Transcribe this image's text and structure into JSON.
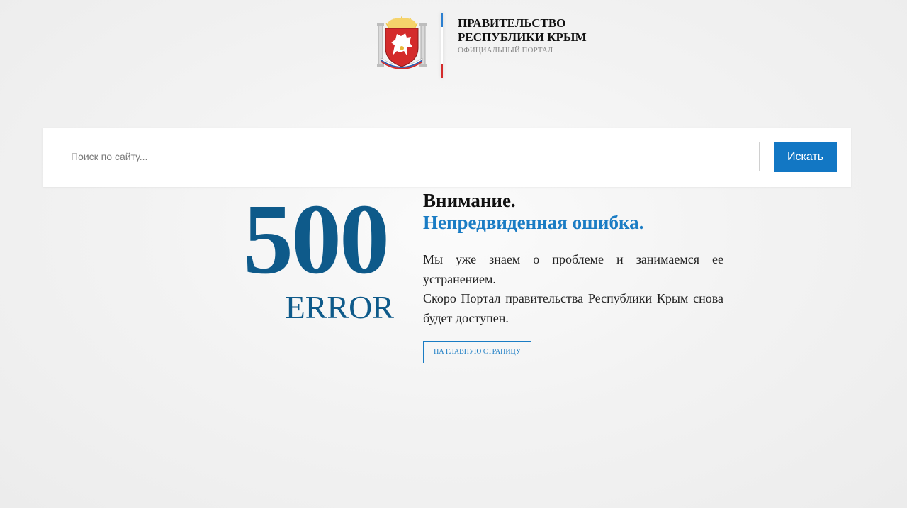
{
  "header": {
    "title_line1": "ПРАВИТЕЛЬСТВО",
    "title_line2": "РЕСПУБЛИКИ КРЫМ",
    "subtitle": "ОФИЦИАЛЬНЫЙ ПОРТАЛ",
    "emblem_icon": "crimea-coat-of-arms-icon"
  },
  "search": {
    "placeholder": "Поиск по сайту...",
    "value": "",
    "button_label": "Искать"
  },
  "error": {
    "code": "500",
    "word": "ERROR",
    "heading": "Внимание.",
    "subheading": "Непредвиденная ошибка.",
    "description_line1": "Мы уже знаем о проблеме и занимаемся ее устранением.",
    "description_line2": "Скоро Портал правительства Республики Крым снова будет доступен.",
    "home_button_label": "НА ГЛАВНУЮ СТРАНИЦУ"
  },
  "colors": {
    "accent": "#1277c4",
    "error_code": "#0e5a8a",
    "subheading": "#1a7cc4",
    "emblem_red": "#d42b2b",
    "emblem_gold": "#e8b83a"
  }
}
